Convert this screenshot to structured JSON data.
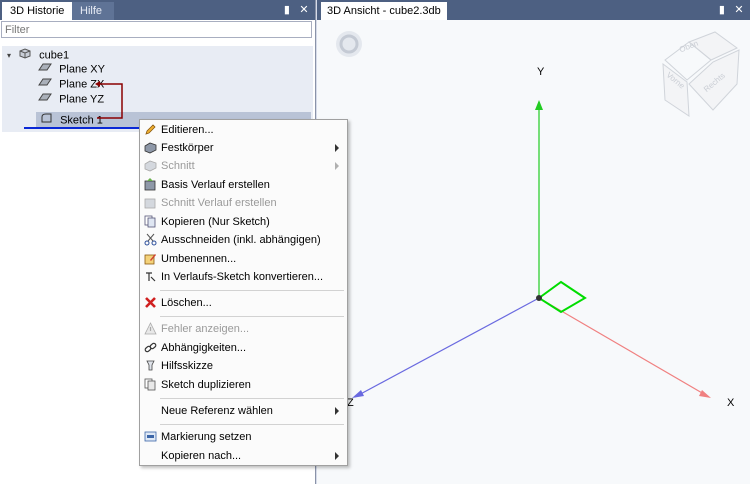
{
  "left_panel": {
    "tabs": [
      {
        "label": "3D Historie"
      },
      {
        "label": "Hilfe"
      }
    ],
    "pin_icon": "pin-icon",
    "close_icon": "close-icon",
    "filter": {
      "placeholder": "Filter",
      "value": ""
    },
    "tree": {
      "root": "cube1",
      "items": [
        "Plane XY",
        "Plane ZX",
        "Plane YZ",
        "Sketch 1"
      ]
    }
  },
  "right_panel": {
    "tab_label": "3D Ansicht - cube2.3db",
    "axes": {
      "x": "X",
      "y": "Y",
      "z": "Z"
    },
    "view_cube": {
      "top": "Oben",
      "front": "Vorne",
      "right": "Rechts"
    }
  },
  "context_menu": {
    "items": [
      {
        "label": "Editieren...",
        "icon": "pencil-icon",
        "disabled": false,
        "submenu": false
      },
      {
        "label": "Festkörper",
        "icon": "solid-icon",
        "disabled": false,
        "submenu": true
      },
      {
        "label": "Schnitt",
        "icon": "cut-icon",
        "disabled": true,
        "submenu": true
      },
      {
        "label": "Basis Verlauf erstellen",
        "icon": "loft-icon",
        "disabled": false,
        "submenu": false
      },
      {
        "label": "Schnitt Verlauf erstellen",
        "icon": "loft-cut-icon",
        "disabled": true,
        "submenu": false
      },
      {
        "label": "Kopieren (Nur Sketch)",
        "icon": "copy-icon",
        "disabled": false,
        "submenu": false
      },
      {
        "label": "Ausschneiden (inkl. abhängigen)",
        "icon": "scissors-icon",
        "disabled": false,
        "submenu": false
      },
      {
        "label": "Umbenennen...",
        "icon": "rename-icon",
        "disabled": false,
        "submenu": false
      },
      {
        "label": "In Verlaufs-Sketch konvertieren...",
        "icon": "convert-icon",
        "disabled": false,
        "submenu": false
      },
      {
        "label": "Löschen...",
        "icon": "delete-icon",
        "disabled": false,
        "submenu": false
      },
      {
        "label": "Fehler anzeigen...",
        "icon": "warning-icon",
        "disabled": true,
        "submenu": false
      },
      {
        "label": "Abhängigkeiten...",
        "icon": "link-icon",
        "disabled": false,
        "submenu": false
      },
      {
        "label": "Hilfsskizze",
        "icon": "helper-sketch-icon",
        "disabled": false,
        "submenu": false
      },
      {
        "label": "Sketch duplizieren",
        "icon": "duplicate-icon",
        "disabled": false,
        "submenu": false
      },
      {
        "label": "Neue Referenz wählen",
        "icon": "",
        "disabled": false,
        "submenu": true
      },
      {
        "label": "Markierung setzen",
        "icon": "marker-icon",
        "disabled": false,
        "submenu": false
      },
      {
        "label": "Kopieren nach...",
        "icon": "",
        "disabled": false,
        "submenu": true
      }
    ]
  },
  "colors": {
    "tab_bar": "#4d6082",
    "selection": "#b9c3d6",
    "axis_x": "#f08080",
    "axis_y": "#22cc22",
    "axis_z": "#6a6ae0",
    "sketch_square": "#00dd00"
  }
}
